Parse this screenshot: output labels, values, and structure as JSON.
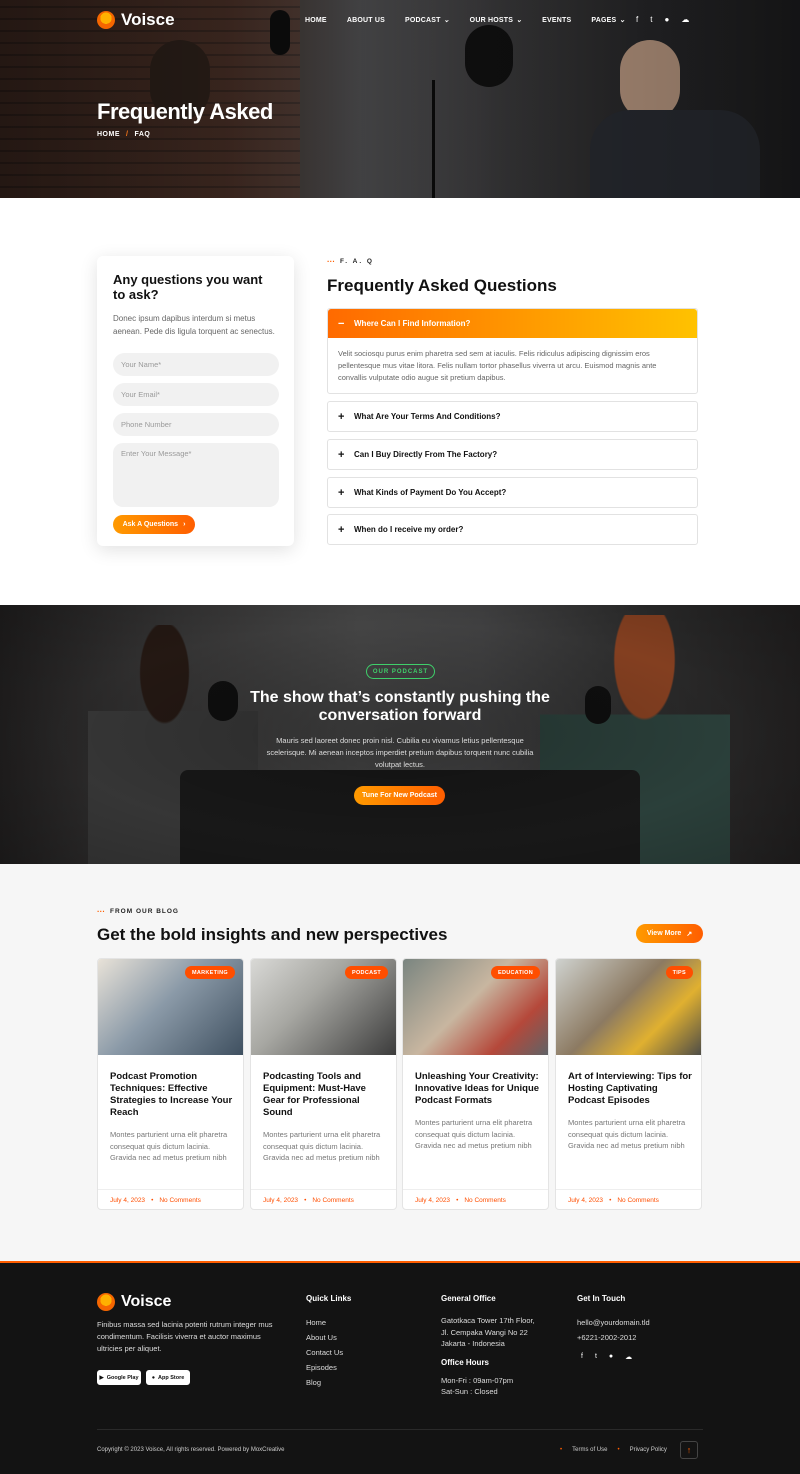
{
  "brand": {
    "name": "Voisce",
    "accent": "#ff5e00",
    "accent2": "#ffb100"
  },
  "nav": {
    "items": [
      {
        "label": "HOME",
        "dropdown": false
      },
      {
        "label": "ABOUT US",
        "dropdown": false
      },
      {
        "label": "PODCAST",
        "dropdown": true
      },
      {
        "label": "OUR HOSTS",
        "dropdown": true
      },
      {
        "label": "EVENTS",
        "dropdown": false
      },
      {
        "label": "PAGES",
        "dropdown": true
      }
    ],
    "social": [
      "facebook-icon",
      "twitter-icon",
      "dribbble-icon",
      "soundcloud-icon"
    ]
  },
  "hero": {
    "title": "Frequently Asked",
    "breadcrumb": {
      "home": "HOME",
      "sep": "/",
      "current": "FAQ"
    }
  },
  "form": {
    "title": "Any questions you want to ask?",
    "text": "Donec ipsum dapibus interdum si metus aenean. Pede dis ligula torquent ac senectus.",
    "name_placeholder": "Your Name*",
    "email_placeholder": "Your Email*",
    "phone_placeholder": "Phone Number",
    "message_placeholder": "Enter Your Message*",
    "submit": "Ask A Questions"
  },
  "faq": {
    "eyebrow": "F. A. Q",
    "title": "Frequently Asked Questions",
    "items": [
      {
        "q": "Where Can I Find Information?",
        "open": true,
        "a": "Velit sociosqu purus enim pharetra sed sem at iaculis. Felis ridiculus adipiscing dignissim eros pellentesque mus vitae litora. Felis nullam tortor phasellus viverra ut arcu. Euismod magnis ante convallis vulputate odio augue sit pretium dapibus."
      },
      {
        "q": "What Are Your Terms And Conditions?",
        "open": false
      },
      {
        "q": "Can I Buy Directly From The Factory?",
        "open": false
      },
      {
        "q": "What Kinds of Payment Do You Accept?",
        "open": false
      },
      {
        "q": "When do I receive my order?",
        "open": false
      }
    ]
  },
  "podcast": {
    "badge": "OUR PODCAST",
    "title": "The show that’s constantly pushing the conversation forward",
    "text": "Mauris sed laoreet donec proin nisl. Cubilia eu vivamus letius pellentesque scelerisque. Mi aenean inceptos imperdiet pretium dapibus torquent nunc cubilia volutpat lectus.",
    "button": "Tune For New Podcast"
  },
  "blog": {
    "eyebrow": "FROM OUR BLOG",
    "title": "Get the bold insights and new perspectives",
    "view_more": "View More",
    "posts": [
      {
        "tag": "MARKETING",
        "title": "Podcast Promotion Techniques: Effective Strategies to Increase Your Reach",
        "excerpt": "Montes parturient urna elit pharetra consequat quis dictum lacinia. Gravida nec ad metus pretium nibh",
        "date": "July 4, 2023",
        "comments": "No Comments"
      },
      {
        "tag": "PODCAST",
        "title": "Podcasting Tools and Equipment: Must-Have Gear for Professional Sound",
        "excerpt": "Montes parturient urna elit pharetra consequat quis dictum lacinia. Gravida nec ad metus pretium nibh",
        "date": "July 4, 2023",
        "comments": "No Comments"
      },
      {
        "tag": "EDUCATION",
        "title": "Unleashing Your Creativity: Innovative Ideas for Unique Podcast Formats",
        "excerpt": "Montes parturient urna elit pharetra consequat quis dictum lacinia. Gravida nec ad metus pretium nibh",
        "date": "July 4, 2023",
        "comments": "No Comments"
      },
      {
        "tag": "TIPS",
        "title": "Art of Interviewing: Tips for Hosting Captivating Podcast Episodes",
        "excerpt": "Montes parturient urna elit pharetra consequat quis dictum lacinia. Gravida nec ad metus pretium nibh",
        "date": "July 4, 2023",
        "comments": "No Comments"
      }
    ]
  },
  "footer": {
    "about": "Finibus massa sed lacinia potenti rutrum integer mus condimentum. Facilisis viverra et auctor maximus ultricies per aliquet.",
    "google_play": "Google Play",
    "app_store": "App Store",
    "quick_links": {
      "title": "Quick Links",
      "items": [
        "Home",
        "About Us",
        "Contact Us",
        "Episodes",
        "Blog"
      ]
    },
    "office": {
      "title": "General Office",
      "lines": [
        "Gatotkaca Tower 17th Floor,",
        "Jl. Cempaka Wangi No 22",
        "Jakarta - Indonesia"
      ],
      "hours_title": "Office Hours",
      "hours": [
        "Mon-Fri : 09am-07pm",
        "Sat-Sun : Closed"
      ]
    },
    "touch": {
      "title": "Get In Touch",
      "email": "hello@yourdomain.tld",
      "phone": "+6221-2002-2012"
    },
    "copyright": "Copyright © 2023 Voisce, All rights reserved. Powered by MoxCreative",
    "terms": "Terms of Use",
    "privacy": "Privacy Policy"
  }
}
